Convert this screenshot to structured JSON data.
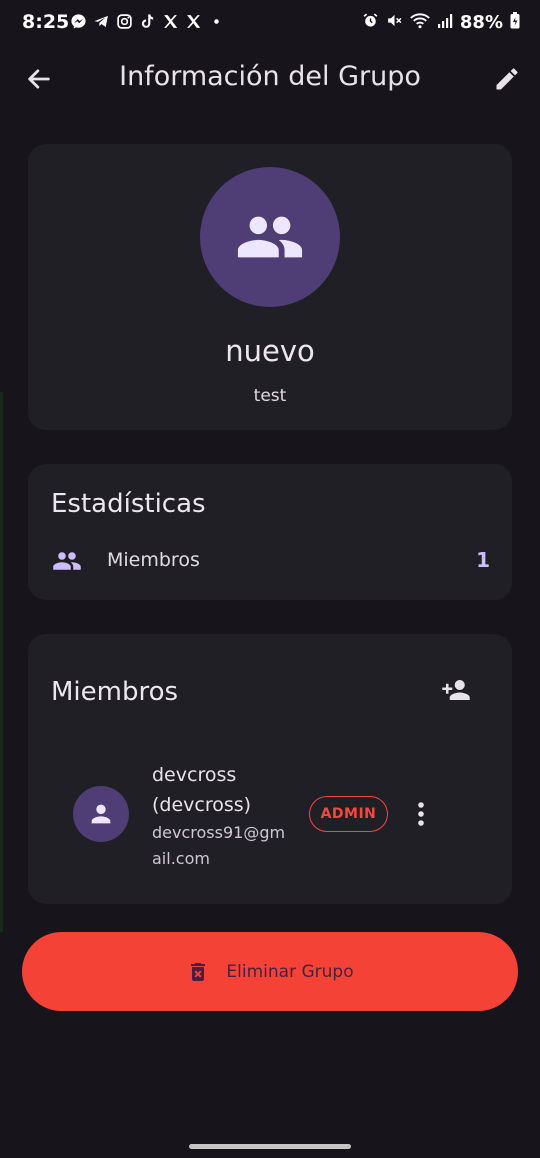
{
  "status_bar": {
    "time": "8:25",
    "battery": "88%",
    "left_icons": [
      "messenger-icon",
      "telegram-icon",
      "instagram-icon",
      "tiktok-icon",
      "x-icon",
      "x-icon",
      "dot-icon"
    ],
    "right_icons": [
      "alarm-icon",
      "mute-icon",
      "wifi-icon",
      "signal-icon",
      "battery-icon"
    ]
  },
  "app_bar": {
    "title": "Información del Grupo",
    "back_icon": "arrow-left-icon",
    "edit_icon": "pencil-icon"
  },
  "group": {
    "name": "nuevo",
    "description": "test",
    "avatar_icon": "group-icon"
  },
  "stats": {
    "title": "Estadísticas",
    "rows": [
      {
        "icon": "group-icon",
        "label": "Miembros",
        "value": "1"
      }
    ]
  },
  "members": {
    "title": "Miembros",
    "add_icon": "person-add-icon",
    "list": [
      {
        "name": "devcross (devcross)",
        "email": "devcross91@gmail.com",
        "role": "ADMIN",
        "avatar_icon": "person-icon",
        "menu_icon": "more-vert-icon"
      }
    ]
  },
  "delete_button": {
    "label": "Eliminar Grupo",
    "icon": "delete-forever-icon"
  },
  "colors": {
    "background": "#17151b",
    "card": "#211f26",
    "avatar": "#4f3e76",
    "accent": "#cdbdff",
    "danger": "#f44336"
  }
}
